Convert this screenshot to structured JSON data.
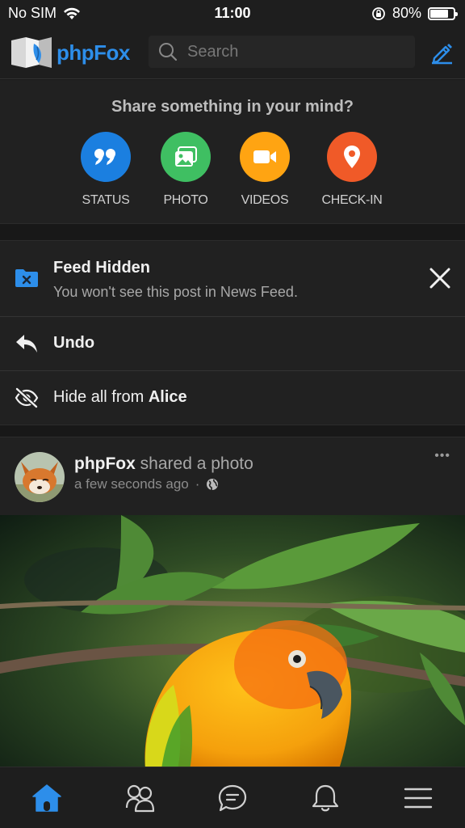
{
  "status_bar": {
    "carrier": "No SIM",
    "time": "11:00",
    "battery_percent": "80%",
    "battery_level": 0.8
  },
  "header": {
    "logo_text": "phpFox",
    "search_placeholder": "Search"
  },
  "share": {
    "title": "Share something in your mind?",
    "actions": [
      {
        "label": "STATUS",
        "icon": "quote-icon",
        "color": "#1b7fe0"
      },
      {
        "label": "PHOTO",
        "icon": "photo-icon",
        "color": "#3fbf62"
      },
      {
        "label": "VIDEOS",
        "icon": "video-icon",
        "color": "#ffa412"
      },
      {
        "label": "CHECK-IN",
        "icon": "location-pin-icon",
        "color": "#f05a28"
      }
    ]
  },
  "feed_hidden": {
    "title": "Feed Hidden",
    "subtitle": "You won't see this post in News Feed.",
    "undo_label": "Undo",
    "hide_all_prefix": "Hide all from ",
    "hide_all_name": "Alice"
  },
  "post": {
    "author": "phpFox",
    "action": " shared a photo",
    "time": "a few seconds ago",
    "separator": "·",
    "more": "•••"
  },
  "bottom_nav": {
    "items": [
      "home-icon",
      "friends-icon",
      "chat-icon",
      "bell-icon",
      "menu-icon"
    ],
    "active_color": "#2d8eea"
  }
}
